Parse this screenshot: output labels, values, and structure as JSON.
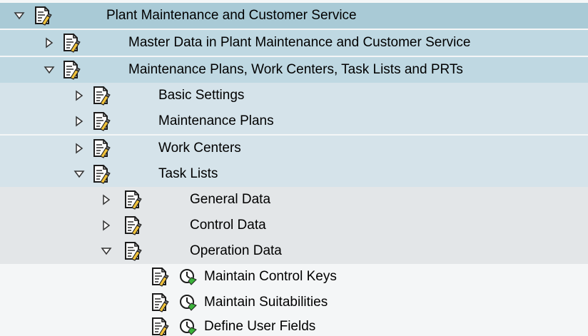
{
  "tree": {
    "nodes": [
      {
        "label": "Plant Maintenance and Customer Service",
        "state": "expanded",
        "level": 0
      },
      {
        "label": "Master Data in Plant Maintenance and Customer Service",
        "state": "collapsed",
        "level": 1
      },
      {
        "label": "Maintenance Plans, Work Centers, Task Lists and PRTs",
        "state": "expanded",
        "level": 1
      },
      {
        "label": "Basic Settings",
        "state": "collapsed",
        "level": 2
      },
      {
        "label": "Maintenance Plans",
        "state": "collapsed",
        "level": 2
      },
      {
        "label": "Work Centers",
        "state": "collapsed",
        "level": 2
      },
      {
        "label": "Task Lists",
        "state": "expanded",
        "level": 2
      },
      {
        "label": "General Data",
        "state": "collapsed",
        "level": 3
      },
      {
        "label": "Control Data",
        "state": "collapsed",
        "level": 3
      },
      {
        "label": "Operation Data",
        "state": "expanded",
        "level": 3
      },
      {
        "label": "Maintain Control Keys",
        "state": "leaf",
        "level": 4,
        "icon": "activity-clock-icon"
      },
      {
        "label": "Maintain Suitabilities",
        "state": "leaf",
        "level": 4,
        "icon": "activity-clock-icon"
      },
      {
        "label": "Define User Fields",
        "state": "leaf",
        "level": 4,
        "icon": "activity-clock-icon"
      }
    ]
  },
  "icons": {
    "expanded": "triangle-down-icon",
    "collapsed": "triangle-right-icon",
    "document": "document-edit-icon",
    "activity": "activity-clock-icon"
  },
  "colors": {
    "level0_bg": "#a9cad6",
    "level1_bg": "#bfd8e2",
    "level2_bg": "#d5e3ea",
    "level3_bg": "#e3e6e8",
    "level4_bg": "#f4f6f7",
    "clock_green": "#3bb33b"
  }
}
